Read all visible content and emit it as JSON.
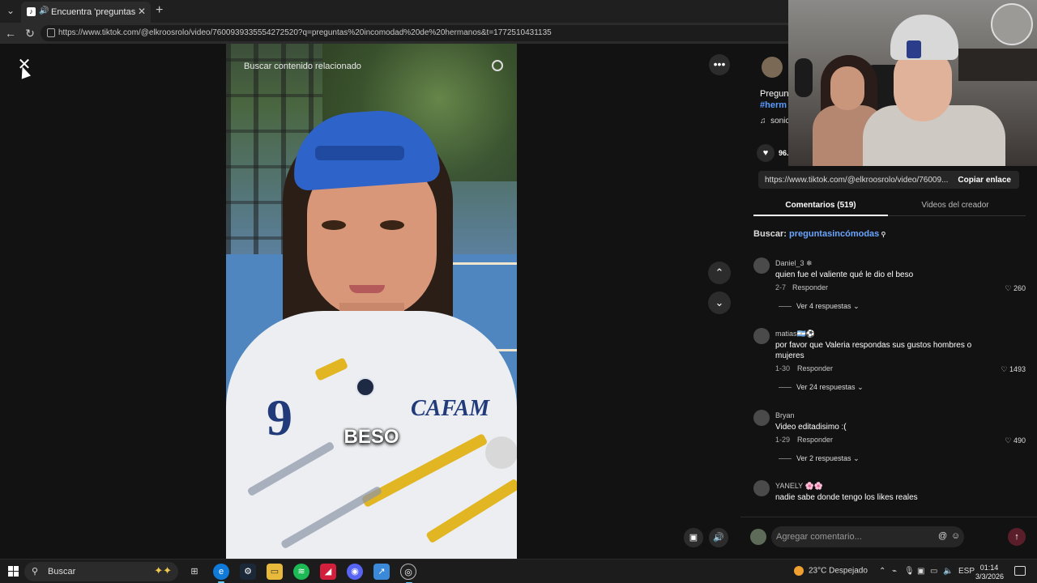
{
  "browser": {
    "tab_title": "Encuentra 'preguntas incomo",
    "url": "https://www.tiktok.com/@elkroosrolo/video/7600939335554272520?q=preguntas%20incomodad%20de%20hermanos&t=1772510431135"
  },
  "video": {
    "search_placeholder": "Buscar contenido relacionado",
    "caption": "BESO",
    "jersey_number": "9",
    "jersey_brand": "CAFAM"
  },
  "post": {
    "title_partial": "Pregun",
    "hashtag_partial": "#herm",
    "music_partial": "sonic",
    "likes_partial": "96.",
    "link": "https://www.tiktok.com/@elkroosrolo/video/76009...",
    "copy_link_label": "Copiar enlace"
  },
  "tabs": {
    "comments": "Comentarios (519)",
    "creator_videos": "Videos del creador"
  },
  "search_line": {
    "label": "Buscar:",
    "keyword": "preguntasincómodas"
  },
  "comments": [
    {
      "user": "Daniel_3 ❄",
      "text": "quien fue el valiente qué le dio el beso",
      "date": "2-7",
      "reply": "Responder",
      "likes": "260",
      "view_replies": "Ver 4 respuestas"
    },
    {
      "user": "matias🇦🇷⚽",
      "text": "por favor que Valeria respondas sus gustos hombres o mujeres",
      "date": "1-30",
      "reply": "Responder",
      "likes": "1493",
      "view_replies": "Ver 24 respuestas"
    },
    {
      "user": "Bryan",
      "text": "Video editadisimo :(",
      "date": "1-29",
      "reply": "Responder",
      "likes": "490",
      "view_replies": "Ver 2 respuestas"
    },
    {
      "user": "YANELY 🌸🌸",
      "text": "nadie sabe donde tengo los likes reales",
      "date": "",
      "reply": "",
      "likes": "",
      "view_replies": ""
    }
  ],
  "comment_input": {
    "placeholder": "Agregar comentario..."
  },
  "taskbar": {
    "search": "Buscar",
    "weather": "23°C  Despejado",
    "lang": "ESP",
    "time": "01:14",
    "date": "3/3/2026"
  },
  "colors": {
    "hashtag": "#5b9bff",
    "accent_underline": "#ffffff",
    "send_button": "#5a1e2a"
  }
}
